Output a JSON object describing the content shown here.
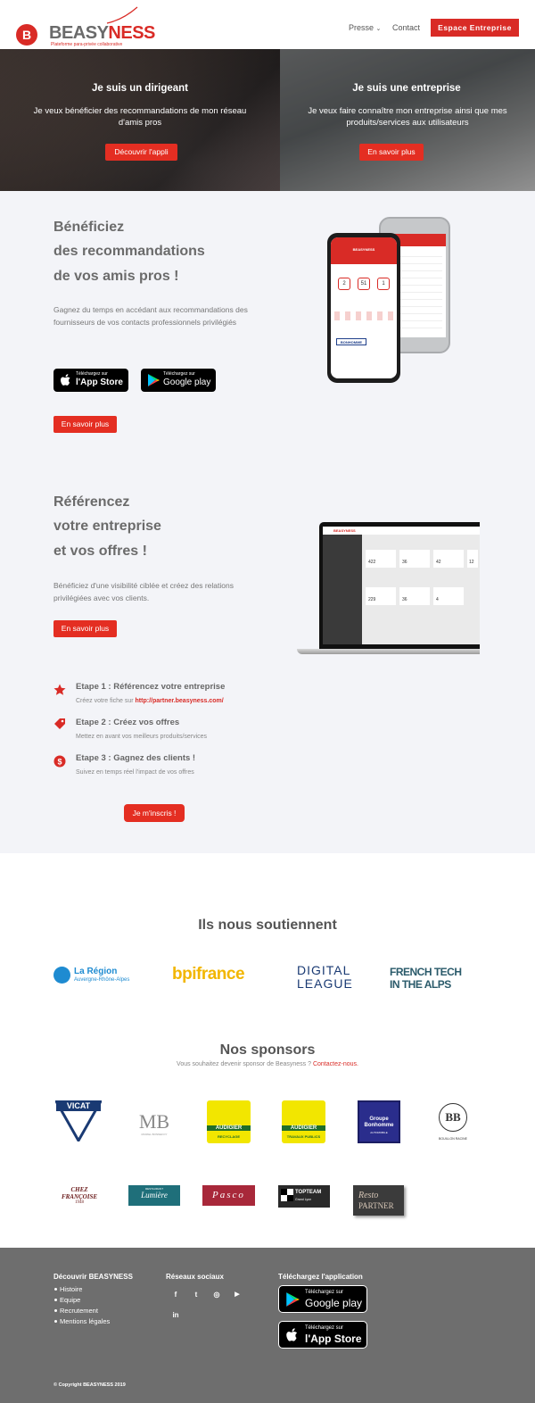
{
  "header": {
    "logo_letter": "B",
    "logo_prefix": "BEASY",
    "logo_suffix": "NESS",
    "logo_tagline": "Plateforme para-privée collaborative",
    "nav": {
      "presse": "Presse",
      "contact": "Contact",
      "espace": "Espace Entreprise"
    }
  },
  "hero": {
    "left": {
      "title": "Je suis un dirigeant",
      "text": "Je veux bénéficier des recommandations de mon réseau d'amis pros",
      "button": "Découvrir l'appli"
    },
    "right": {
      "title": "Je suis une entreprise",
      "text": "Je veux faire connaître mon entreprise ainsi que mes produits/services aux utilisateurs",
      "button": "En savoir plus"
    }
  },
  "section1": {
    "heading": [
      "Bénéficiez",
      "des recommandations",
      "de vos amis pros !"
    ],
    "text": "Gagnez du temps en accédant aux recommandations des fournisseurs de vos contacts professionnels privilégiés",
    "appstore": {
      "small": "Téléchargez sur",
      "big": "l'App Store"
    },
    "googleplay": {
      "small": "Téléchargez sur",
      "big": "Google play"
    },
    "button": "En savoir plus",
    "phone": {
      "brand": "BEASYNESS",
      "stats": [
        "2",
        "51",
        "1"
      ],
      "partner": "BONHOMME"
    }
  },
  "section2": {
    "heading": [
      "Référencez",
      "votre entreprise",
      "et vos offres !"
    ],
    "text": "Bénéficiez d'une visibilité ciblée et créez des relations privilégiées avec vos clients.",
    "button": "En savoir plus",
    "laptop": {
      "brand": "BEASYNESS",
      "tiles": [
        "422",
        "36",
        "42",
        "12",
        "229",
        "36",
        "4"
      ]
    }
  },
  "steps": [
    {
      "title": "Etape 1 : Référencez votre entreprise",
      "sub": "Créez votre fiche sur ",
      "link": "http://partner.beasyness.com/"
    },
    {
      "title": "Etape 2 : Créez vos offres",
      "sub": "Mettez en avant vos meilleurs produits/services",
      "link": ""
    },
    {
      "title": "Etape 3 : Gagnez des clients !",
      "sub": "Suivez en temps réel l'impact de vos offres",
      "link": ""
    }
  ],
  "signup_button": "Je m'inscris !",
  "supporters": {
    "title": "Ils nous soutiennent",
    "logos": [
      {
        "line1": "La Région",
        "line2": "Auvergne-Rhône-Alpes"
      },
      {
        "line1": "bpifrance"
      },
      {
        "line1": "DIGITAL",
        "line2": "LEAGUE"
      },
      {
        "line1": "FRENCH TECH",
        "line2": "IN THE ALPS"
      }
    ]
  },
  "sponsors": {
    "title": "Nos sponsors",
    "subtitle": "Vous souhaitez devenir sponsor de Beasyness ? ",
    "subtitle_link": "Contactez-nous.",
    "row1": [
      {
        "text": "VICAT"
      },
      {
        "text": "MB",
        "sub": "MURIEL BONNEFOY"
      },
      {
        "text": "AUDIGIER",
        "sub": "RECYCLAGE"
      },
      {
        "text": "AUDIGIER",
        "sub": "TRAVAUX PUBLICS"
      },
      {
        "text": "Groupe Bonhomme",
        "sub": "AUTOMOBILE"
      },
      {
        "text": "BB",
        "sub": "BOUILLON RACINE"
      }
    ],
    "row2": [
      {
        "text": "CHEZ FRANÇOISE",
        "sub": "1948"
      },
      {
        "text": "Lumière",
        "sub": "RESTAURANT"
      },
      {
        "text": "Pasco"
      },
      {
        "text": "TOPTEAM",
        "sub": "Grand Lyon"
      },
      {
        "text": "Resto",
        "sub": "PARTNER"
      }
    ]
  },
  "footer": {
    "col1_title": "Découvrir BEASYNESS",
    "col1_links": [
      "Histoire",
      "Equipe",
      "Recrutement",
      "Mentions légales"
    ],
    "col2_title": "Réseaux sociaux",
    "social": [
      "f",
      "t",
      "◎",
      "▶",
      "in"
    ],
    "col3_title": "Téléchargez l'application",
    "googleplay": {
      "small": "Téléchargez sur",
      "big": "Google play"
    },
    "appstore": {
      "small": "Téléchargez sur",
      "big": "l'App Store"
    },
    "copyright": "© Copyright BEASYNESS 2019"
  },
  "colors": {
    "accent": "#d92b26",
    "footer": "#6e6e6e",
    "grey_bg": "#f3f4f8"
  }
}
